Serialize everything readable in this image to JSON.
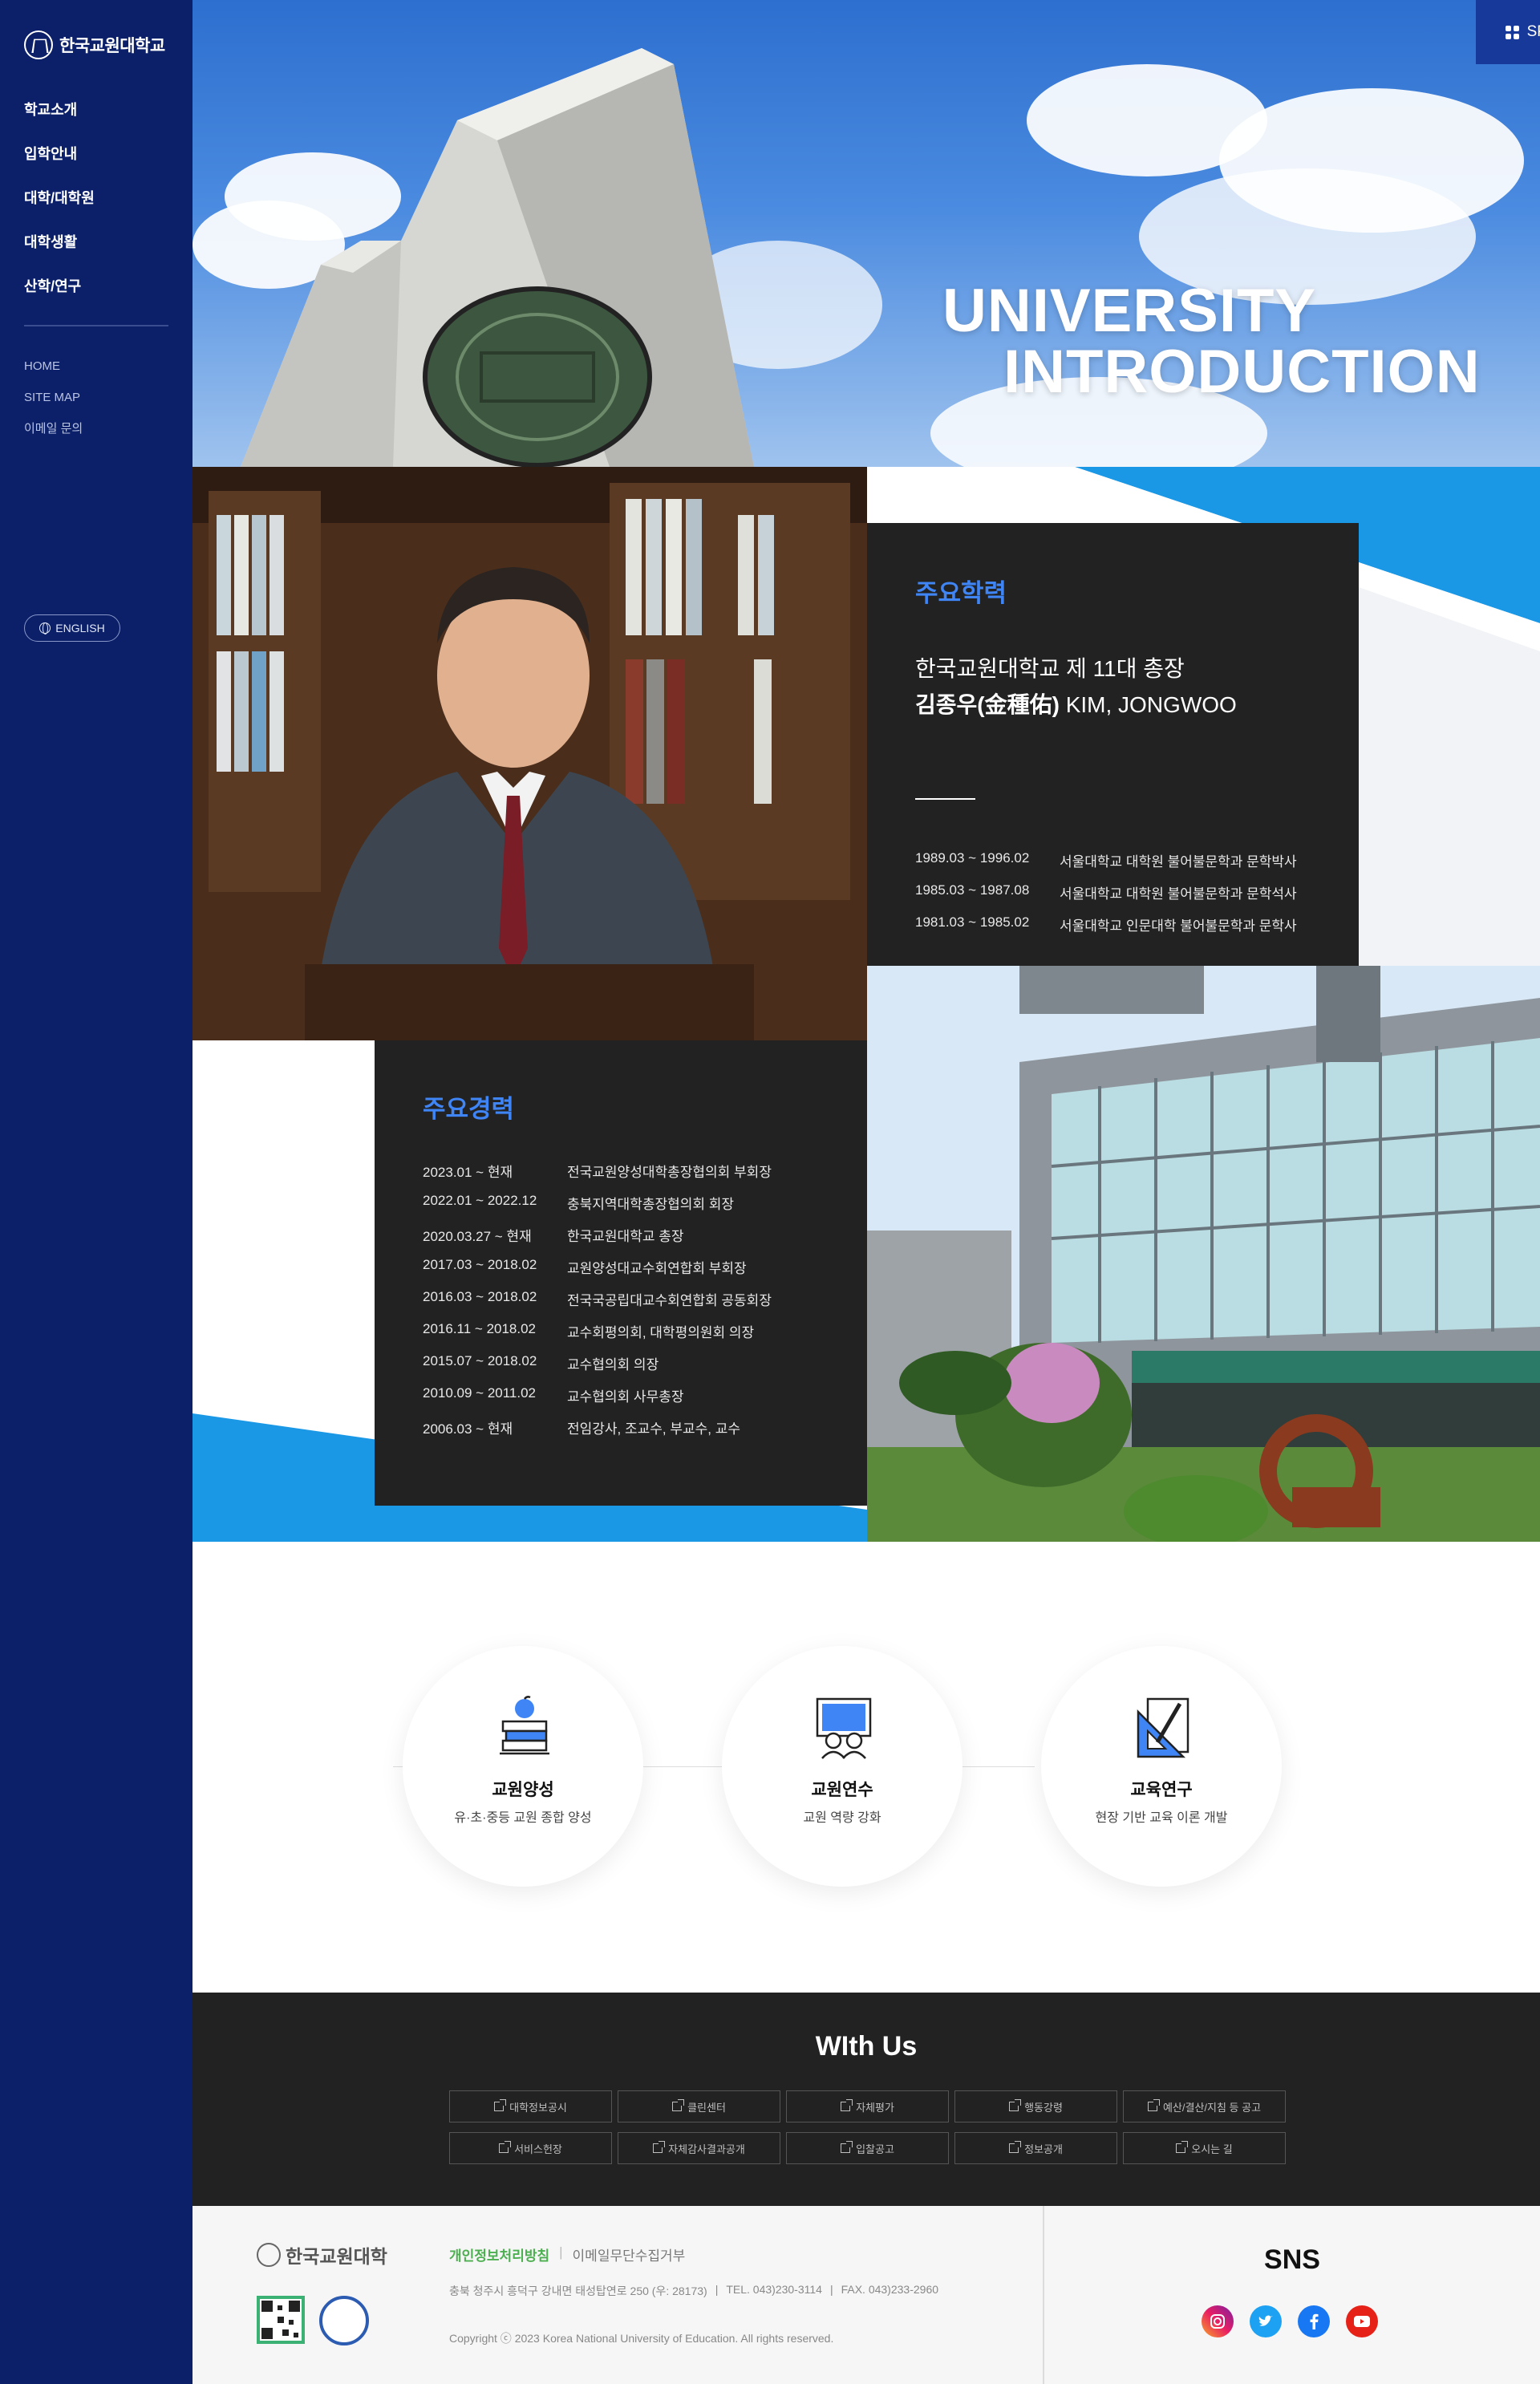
{
  "sidebar": {
    "logo_text": "한국교원대학교",
    "nav": [
      "학교소개",
      "입학안내",
      "대학/대학원",
      "대학생활",
      "산학/연구"
    ],
    "subnav": [
      "HOME",
      "SITE MAP",
      "이메일 문의"
    ],
    "language_button": "ENGLISH"
  },
  "hero": {
    "title_line1": "UNIVERSITY",
    "title_line2": "INTRODUCTION",
    "special_links": "SPECIAL LINKS"
  },
  "education": {
    "title": "주요학력",
    "president_line1": "한국교원대학교 제 11대 총장",
    "president_name": "김종우(金種佑)",
    "president_name_en": " KIM, JONGWOO",
    "items": [
      {
        "date": "1989.03 ~ 1996.02",
        "desc": "서울대학교 대학원 불어불문학과 문학박사"
      },
      {
        "date": "1985.03 ~ 1987.08",
        "desc": "서울대학교 대학원 불어불문학과 문학석사"
      },
      {
        "date": "1981.03 ~ 1985.02",
        "desc": "서울대학교 인문대학 불어불문학과 문학사"
      }
    ]
  },
  "career": {
    "title": "주요경력",
    "items": [
      {
        "date": "2023.01 ~ 현재",
        "desc": "전국교원양성대학총장협의회 부회장"
      },
      {
        "date": "2022.01 ~ 2022.12",
        "desc": "충북지역대학총장협의회 회장"
      },
      {
        "date": "2020.03.27 ~ 현재",
        "desc": "한국교원대학교 총장"
      },
      {
        "date": "2017.03 ~ 2018.02",
        "desc": "교원양성대교수회연합회 부회장"
      },
      {
        "date": "2016.03 ~ 2018.02",
        "desc": "전국국공립대교수회연합회 공동회장"
      },
      {
        "date": "2016.11 ~ 2018.02",
        "desc": "교수회평의회, 대학평의원회 의장"
      },
      {
        "date": "2015.07 ~ 2018.02",
        "desc": "교수협의회 의장"
      },
      {
        "date": "2010.09 ~ 2011.02",
        "desc": "교수협의회 사무총장"
      },
      {
        "date": "2006.03 ~ 현재",
        "desc": "전임강사, 조교수, 부교수, 교수"
      }
    ]
  },
  "features": [
    {
      "title": "교원양성",
      "desc": "유·초·중등 교원 종합 양성",
      "icon": "books-apple-icon"
    },
    {
      "title": "교원연수",
      "desc": "교원 역량 강화",
      "icon": "whiteboard-icon"
    },
    {
      "title": "교육연구",
      "desc": "현장 기반 교육 이론 개발",
      "icon": "ruler-pencil-icon"
    }
  ],
  "withus": {
    "title": "WIth Us",
    "links": [
      "대학정보공시",
      "클린센터",
      "자체평가",
      "행동강령",
      "예산/결산/지침 등 공고",
      "서비스헌장",
      "자체감사결과공개",
      "입찰공고",
      "정보공개",
      "오시는 길"
    ]
  },
  "footer": {
    "logo_text": "한국교원대학",
    "privacy": "개인정보처리방침",
    "email_policy": "이메일무단수집거부",
    "address": "충북 청주시 흥덕구 강내면 태성탑연로 250 (우: 28173)",
    "tel": "TEL. 043)230-3114",
    "fax": "FAX. 043)233-2960",
    "copyright": "Copyright ⓒ 2023 Korea National University of Education. All rights reserved.",
    "sns_title": "SNS",
    "sns": [
      "instagram-icon",
      "twitter-icon",
      "facebook-icon",
      "youtube-icon"
    ]
  },
  "colors": {
    "sidebar_bg": "#0c2069",
    "accent_blue": "#3f85f5",
    "bright_blue": "#1a98e6",
    "dark_panel": "#222222",
    "green_link": "#4caf50"
  }
}
